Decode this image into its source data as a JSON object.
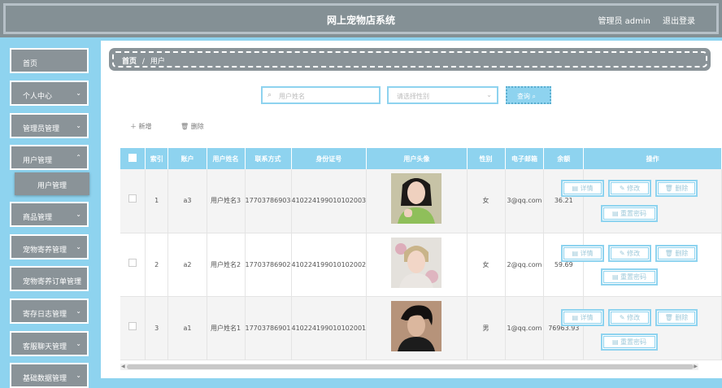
{
  "header": {
    "title": "网上宠物店系统",
    "admin": "管理员 admin",
    "logout": "退出登录"
  },
  "sidebar": {
    "items": [
      {
        "label": "首页",
        "arrow": ""
      },
      {
        "label": "个人中心",
        "arrow": "⌄"
      },
      {
        "label": "管理员管理",
        "arrow": "⌄"
      },
      {
        "label": "用户管理",
        "arrow": "⌃"
      },
      {
        "label": "商品管理",
        "arrow": "⌄"
      },
      {
        "label": "宠物寄养管理",
        "arrow": "⌄"
      },
      {
        "label": "宠物寄养订单管理",
        "arrow": "⌄"
      },
      {
        "label": "寄存日志管理",
        "arrow": "⌄"
      },
      {
        "label": "客服聊天管理",
        "arrow": "⌄"
      },
      {
        "label": "基础数据管理",
        "arrow": "⌄"
      }
    ],
    "submenu": "用户管理"
  },
  "breadcrumb": {
    "home": "首页",
    "sep": "/",
    "current": "用户"
  },
  "search": {
    "placeholder": "用户姓名",
    "select_placeholder": "请选择性别",
    "query": "查询"
  },
  "toolbar": {
    "add": "新增",
    "delete": "删除"
  },
  "table": {
    "headers": [
      "索引",
      "账户",
      "用户姓名",
      "联系方式",
      "身份证号",
      "用户头像",
      "性别",
      "电子邮箱",
      "余额",
      "操作"
    ],
    "rows": [
      {
        "index": "1",
        "account": "a3",
        "name": "用户姓名3",
        "phone": "17703786903",
        "id_card": "410224199010102003",
        "gender": "女",
        "email": "3@qq.com",
        "balance": "36.21"
      },
      {
        "index": "2",
        "account": "a2",
        "name": "用户姓名2",
        "phone": "17703786902",
        "id_card": "410224199010102002",
        "gender": "女",
        "email": "2@qq.com",
        "balance": "59.69"
      },
      {
        "index": "3",
        "account": "a1",
        "name": "用户姓名1",
        "phone": "17703786901",
        "id_card": "410224199010102001",
        "gender": "男",
        "email": "1@qq.com",
        "balance": "76963.93"
      }
    ],
    "actions": {
      "detail": "详情",
      "edit": "修改",
      "delete": "删除",
      "reset": "重置密码"
    }
  },
  "colors": {
    "accent": "#8ed3ef",
    "menu_bg": "#8a9398",
    "header_bg": "#849095"
  }
}
